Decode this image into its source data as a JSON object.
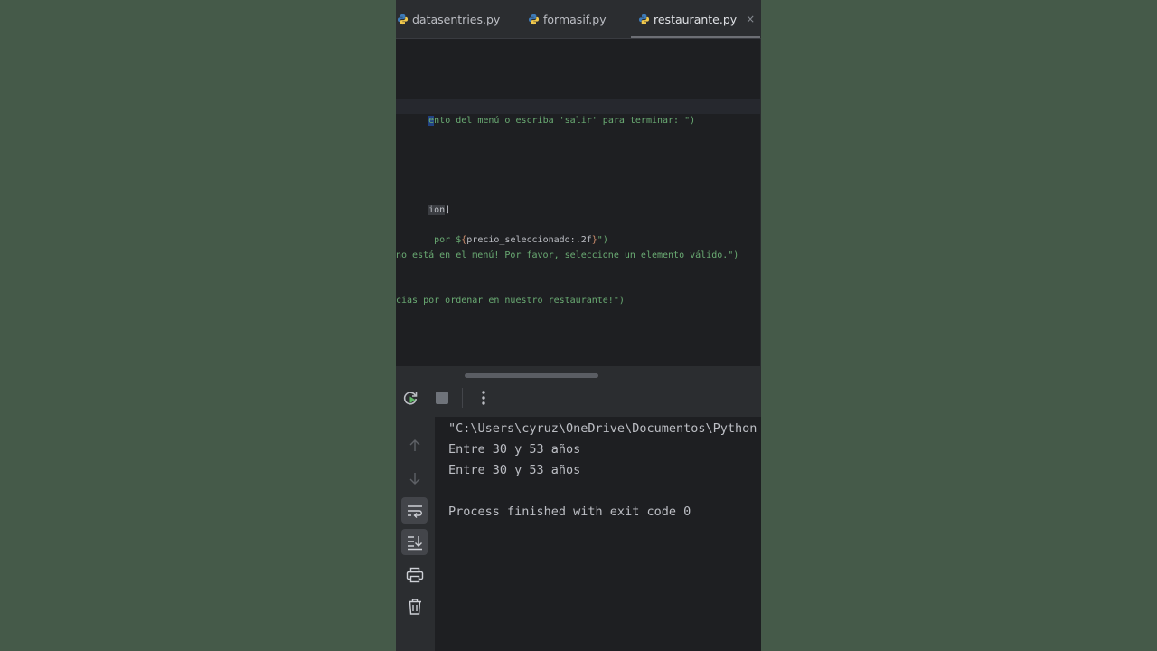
{
  "tabs": [
    {
      "label": "datasentries.py",
      "active": false
    },
    {
      "label": "formasif.py",
      "active": false
    },
    {
      "label": "restaurante.py",
      "active": true
    }
  ],
  "tab_close_glyph": "×",
  "editor": {
    "line1": {
      "selected": "e",
      "rest": "nto del menú o escriba 'salir' para terminar: \")"
    },
    "line2": {
      "selected": "ion",
      "rest": "]"
    },
    "line3": {
      "pre": " por $",
      "brace_open": "{",
      "ident": "precio_seleccionado",
      "fmt": ":.2f",
      "brace_close": "}",
      "post": "\")"
    },
    "line4": "no está en el menú! Por favor, seleccione un elemento válido.\")",
    "line5": "cias por ordenar en nuestro restaurante!\")"
  },
  "console": {
    "lines": [
      "\"C:\\Users\\cyruz\\OneDrive\\Documentos\\Python",
      "Entre 30 y 53 años",
      "Entre 30 y 53 años",
      "",
      "Process finished with exit code 0"
    ]
  },
  "icons": {
    "python": "python-file-icon",
    "rerun": "rerun-icon",
    "stop": "stop-icon",
    "more": "more-vertical-icon",
    "up": "arrow-up-icon",
    "down": "arrow-down-icon",
    "wrap": "soft-wrap-icon",
    "scroll_end": "scroll-to-end-icon",
    "print": "print-icon",
    "trash": "trash-icon"
  },
  "colors": {
    "background": "#455a49",
    "editor_bg": "#1e1f22",
    "panel_bg": "#2b2d30",
    "string_green": "#6aab73",
    "selection_blue": "#214283",
    "run_green": "#5fb865"
  }
}
